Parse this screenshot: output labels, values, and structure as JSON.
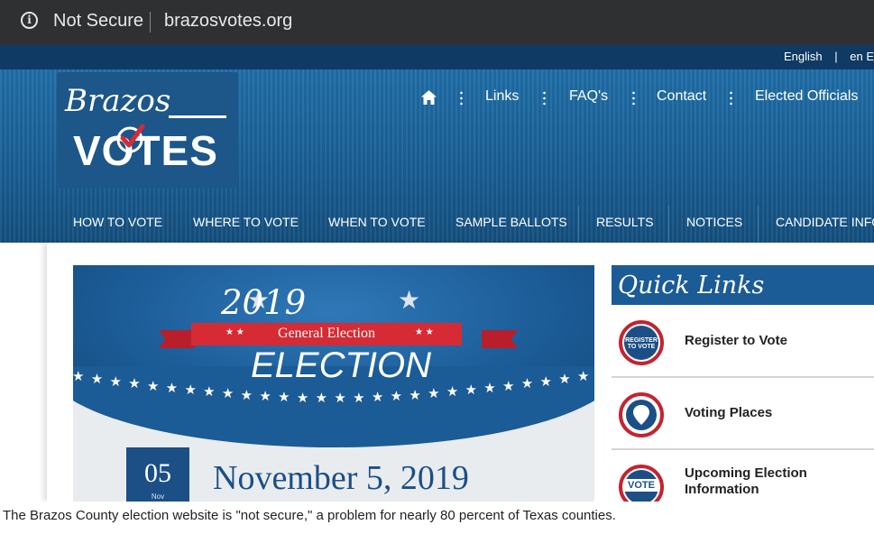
{
  "browser": {
    "security": "Not Secure",
    "url": "brazosvotes.org"
  },
  "top_strip": {
    "lang1": "English",
    "sep": "|",
    "lang2": "en E"
  },
  "logo": {
    "script": "Brazos",
    "main": "VOTES"
  },
  "top_nav": [
    "Links",
    "FAQ's",
    "Contact",
    "Elected Officials"
  ],
  "main_nav": [
    "HOW TO VOTE",
    "WHERE TO VOTE",
    "WHEN TO VOTE",
    "SAMPLE BALLOTS",
    "RESULTS",
    "NOTICES",
    "CANDIDATE INFO"
  ],
  "banner": {
    "year": "2019",
    "ribbon": "General Election",
    "heading": "ELECTION",
    "day": "05",
    "month": "Nov",
    "date": "November 5, 2019"
  },
  "quick_links": {
    "title": "Quick Links",
    "items": [
      "Register to Vote",
      "Voting Places",
      "Upcoming Election Information"
    ],
    "icons": [
      "register-to-vote-badge-icon",
      "map-pin-icon",
      "vote-badge-icon"
    ],
    "badge_texts": [
      "REGISTER TO VOTE",
      "VOTE"
    ]
  },
  "caption": "The Brazos County election website is \"not secure,\" a problem for nearly 80 percent of Texas counties.",
  "colors": {
    "header_blue": "#1a5f96",
    "nav_dark": "#0f3a63",
    "ribbon_red": "#d62a35",
    "date_blue": "#1b4f86"
  }
}
